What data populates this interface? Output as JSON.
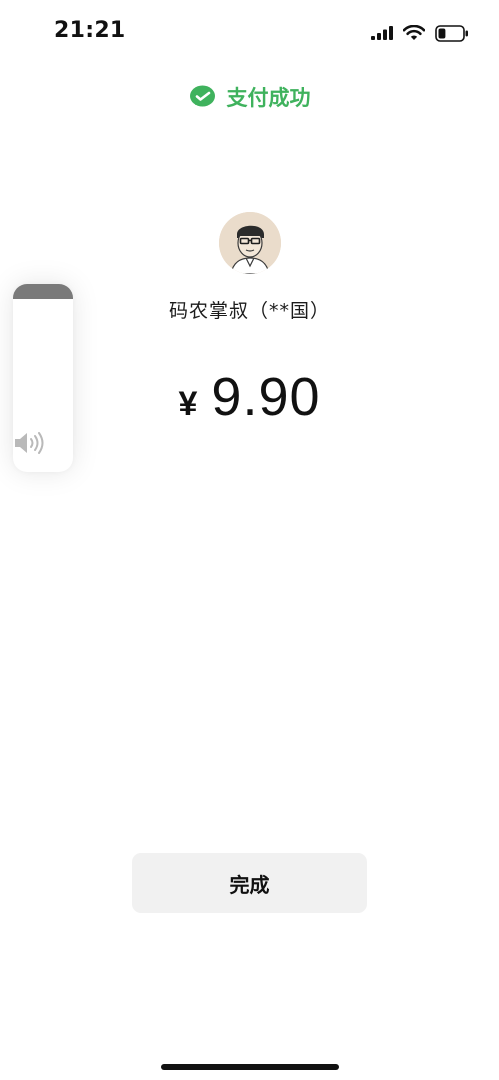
{
  "status_bar": {
    "time": "21:21",
    "signal_icon": "cellular-signal-icon",
    "wifi_icon": "wifi-icon",
    "battery_icon": "battery-icon",
    "battery_level": 0.3
  },
  "header": {
    "icon": "wechat-pay-icon",
    "title": "支付成功",
    "accent_color": "#3fb25d"
  },
  "payee": {
    "avatar_icon": "payee-avatar",
    "name": "码农掌叔（**国）"
  },
  "amount": {
    "currency": "¥",
    "value": "9.90"
  },
  "volume_hud": {
    "icon": "speaker-icon",
    "level": 0.08
  },
  "footer": {
    "done_label": "完成"
  }
}
